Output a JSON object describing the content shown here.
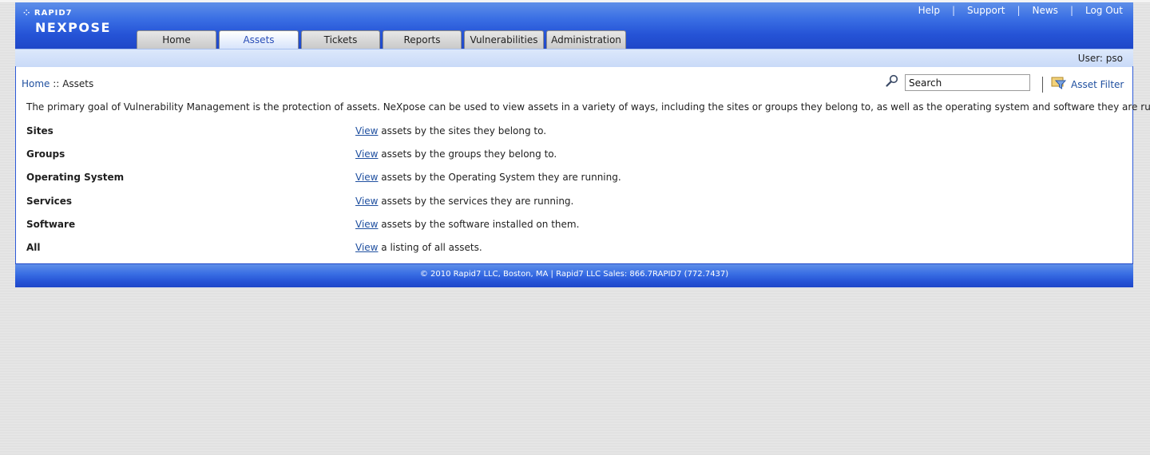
{
  "brand": {
    "company": "RAPID7",
    "product": "NEXPOSE"
  },
  "toplinks": [
    "Help",
    "Support",
    "News",
    "Log Out"
  ],
  "tabs": [
    {
      "label": "Home",
      "active": false
    },
    {
      "label": "Assets",
      "active": true
    },
    {
      "label": "Tickets",
      "active": false
    },
    {
      "label": "Reports",
      "active": false
    },
    {
      "label": "Vulnerabilities",
      "active": false
    },
    {
      "label": "Administration",
      "active": false
    }
  ],
  "user": {
    "text": "User: pso"
  },
  "breadcrumb": {
    "home": "Home",
    "separator": "::",
    "current": "Assets"
  },
  "search": {
    "value": "Search"
  },
  "filter": {
    "label": "Asset Filter"
  },
  "intro": "The primary goal of Vulnerability Management is the protection of assets. NeXpose can be used to view assets in a variety of ways, including the sites or groups they belong to, as well as the operating system and software they are running.",
  "asset_views": [
    {
      "label": "Sites",
      "link": "View",
      "text": " assets by the sites they belong to."
    },
    {
      "label": "Groups",
      "link": "View",
      "text": " assets by the groups they belong to."
    },
    {
      "label": "Operating System",
      "link": "View",
      "text": " assets by the Operating System they are running."
    },
    {
      "label": "Services",
      "link": "View",
      "text": " assets by the services they are running."
    },
    {
      "label": "Software",
      "link": "View",
      "text": " assets by the software installed on them."
    },
    {
      "label": "All",
      "link": "View",
      "text": " a listing of all assets."
    }
  ],
  "footer": {
    "copyright": "© 2010 Rapid7 LLC, Boston, MA | Rapid7 LLC Sales: 866.7RAPID7 (772.7437)"
  },
  "colors": {
    "header_blue": "#2553d6",
    "link_blue": "#2050a0",
    "userbar": "#c9daf8"
  }
}
